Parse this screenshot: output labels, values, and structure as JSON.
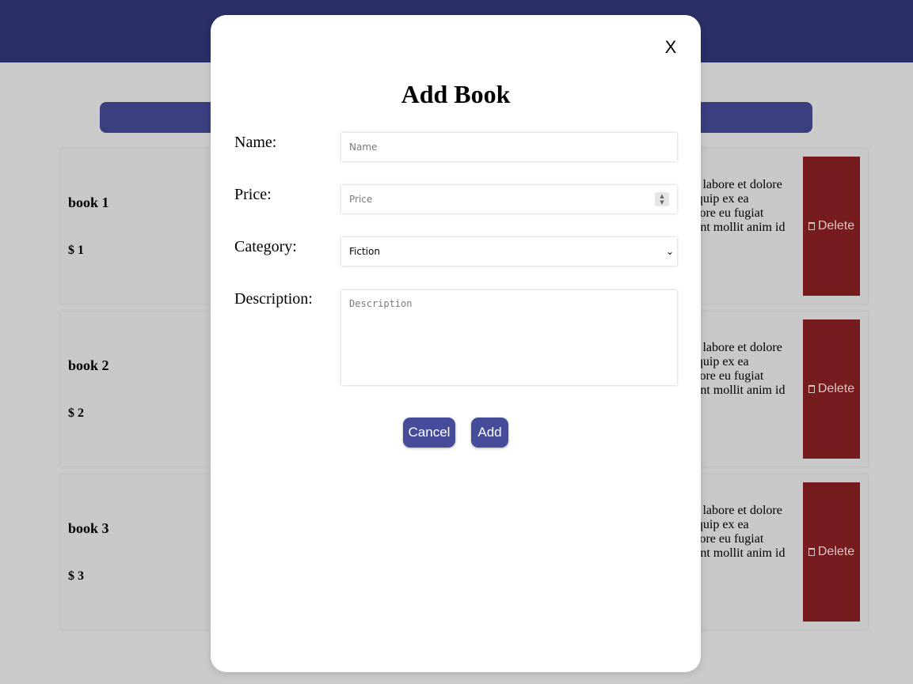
{
  "books": [
    {
      "name": "book 1",
      "price": "$ 1",
      "delete_label": "Delete",
      "desc_lines": [
        "ut labore et dolore",
        "liquip ex ea",
        "olore eu fugiat",
        "runt mollit anim id"
      ]
    },
    {
      "name": "book 2",
      "price": "$ 2",
      "delete_label": "Delete",
      "desc_lines": [
        "ut labore et dolore",
        "liquip ex ea",
        "olore eu fugiat",
        "runt mollit anim id"
      ]
    },
    {
      "name": "book 3",
      "price": "$ 3",
      "delete_label": "Delete",
      "desc_lines": [
        "ut labore et dolore",
        "liquip ex ea",
        "olore eu fugiat",
        "runt mollit anim id"
      ]
    }
  ],
  "modal": {
    "close_label": "X",
    "title": "Add Book",
    "name_label": "Name:",
    "name_placeholder": "Name",
    "price_label": "Price:",
    "price_placeholder": "Price",
    "category_label": "Category:",
    "category_selected": "Fiction",
    "description_label": "Description:",
    "description_placeholder": "Description",
    "cancel_label": "Cancel",
    "add_label": "Add"
  },
  "colors": {
    "topbar": "#2b2f68",
    "searchbar": "#3b3f80",
    "delete": "#761b1e",
    "button": "#464b9a",
    "page_bg": "#cbcbcb"
  },
  "icons": {
    "delete": "trash-icon",
    "select": "chevron-down-icon",
    "number": "spinner-icon"
  }
}
